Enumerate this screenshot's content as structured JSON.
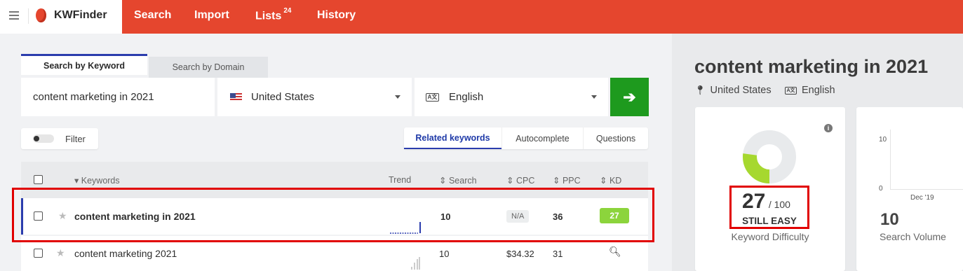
{
  "brand": {
    "name": "KWFinder"
  },
  "nav": {
    "search": "Search",
    "import": "Import",
    "lists": "Lists",
    "lists_count": "24",
    "history": "History"
  },
  "tabs": {
    "by_keyword": "Search by Keyword",
    "by_domain": "Search by Domain"
  },
  "search": {
    "keyword": "content marketing in 2021",
    "location": "United States",
    "language": "English",
    "go_icon": "arrow-right-icon"
  },
  "filter": {
    "label": "Filter"
  },
  "modes": [
    "Related keywords",
    "Autocomplete",
    "Questions"
  ],
  "table": {
    "headers": {
      "keywords": "Keywords",
      "trend": "Trend",
      "search": "Search",
      "cpc": "CPC",
      "ppc": "PPC",
      "kd": "KD"
    },
    "rows": [
      {
        "keyword": "content marketing in 2021",
        "search": "10",
        "cpc": "N/A",
        "ppc": "36",
        "kd": "27",
        "kd_color": "#8cd43c"
      },
      {
        "keyword": "content marketing 2021",
        "search": "10",
        "cpc": "$34.32",
        "ppc": "31",
        "kd_icon": "search-icon"
      }
    ]
  },
  "detail": {
    "title": "content marketing in 2021",
    "location": "United States",
    "language": "English",
    "kd_value": "27",
    "kd_max": "/ 100",
    "kd_label": "STILL EASY",
    "kd_caption": "Keyword Difficulty",
    "kd_fraction": 0.27,
    "volume_value": "10",
    "volume_caption": "Search Volume",
    "chart_ticks": [
      "10",
      "0"
    ],
    "chart_month": "Dec '19"
  },
  "colors": {
    "accent": "#e5462e",
    "primary_blue": "#2b3dad",
    "go_green": "#1e9a1e",
    "kd_green": "#8cd43c",
    "highlight": "#e10000"
  }
}
